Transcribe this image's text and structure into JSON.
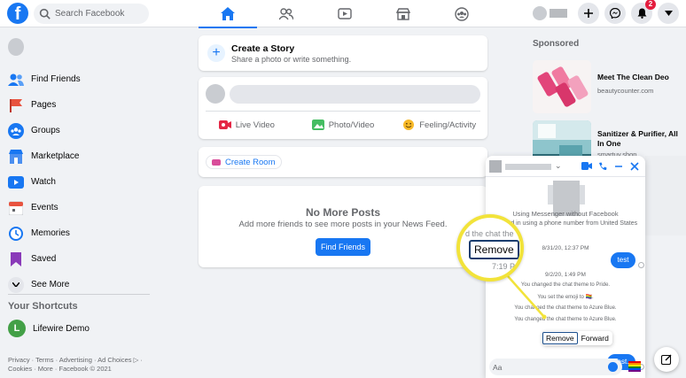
{
  "topbar": {
    "logo": "f",
    "search_placeholder": "Search Facebook",
    "nav_tabs": [
      "home-icon",
      "friends-icon",
      "watch-icon",
      "marketplace-icon",
      "groups-icon"
    ],
    "notification_count": "2"
  },
  "sidebar": {
    "items": [
      {
        "label": "Find Friends",
        "icon": "friends-icon",
        "color": "#1877f2"
      },
      {
        "label": "Pages",
        "icon": "flag-icon",
        "color": "#e8533f"
      },
      {
        "label": "Groups",
        "icon": "groups-icon",
        "color": "#1877f2"
      },
      {
        "label": "Marketplace",
        "icon": "marketplace-icon",
        "color": "#1877f2"
      },
      {
        "label": "Watch",
        "icon": "watch-icon",
        "color": "#1877f2"
      },
      {
        "label": "Events",
        "icon": "calendar-icon",
        "color": "#e8533f"
      },
      {
        "label": "Memories",
        "icon": "clock-icon",
        "color": "#1877f2"
      },
      {
        "label": "Saved",
        "icon": "bookmark-icon",
        "color": "#8a3ab9"
      },
      {
        "label": "See More",
        "icon": "chevron-down-icon",
        "color": "#65676b"
      }
    ],
    "shortcuts_title": "Your Shortcuts",
    "shortcut_label": "Lifewire Demo",
    "shortcut_initial": "L",
    "footer_line1": "Privacy · Terms · Advertising · Ad Choices ▷ ·",
    "footer_line2": "Cookies · More · Facebook © 2021"
  },
  "feed": {
    "story_title": "Create a Story",
    "story_sub": "Share a photo or write something.",
    "actions": [
      "Live Video",
      "Photo/Video",
      "Feeling/Activity"
    ],
    "create_room": "Create Room",
    "no_more_title": "No More Posts",
    "no_more_sub": "Add more friends to see more posts in your News Feed.",
    "find_friends_button": "Find Friends"
  },
  "sponsored": {
    "title": "Sponsored",
    "ads": [
      {
        "title": "Meet The Clean Deo",
        "url": "beautycounter.com"
      },
      {
        "title": "Sanitizer & Purifier, All In One",
        "url": "smartuv.shop"
      }
    ]
  },
  "messenger": {
    "info_line1": "Using Messenger without Facebook",
    "info_line2": "Logged in using a phone number from United States",
    "time1": "8/31/20, 12:37 PM",
    "msg1": "test",
    "time2": "9/2/20, 1:49 PM",
    "sys1": "You changed the chat theme to Pride.",
    "sys2": "You set the emoji to 🏳️‍🌈.",
    "sys3": "You changed the chat theme to Azure Blue.",
    "sys4": "You changed the chat theme to Azure Blue.",
    "context_remove": "Remove",
    "context_forward": "Forward",
    "msg2": "Test.",
    "input_placeholder": "Aa"
  },
  "zoom": {
    "text_top": "d the chat the",
    "remove_label": "Remove",
    "text_bottom": "7:19 P"
  }
}
